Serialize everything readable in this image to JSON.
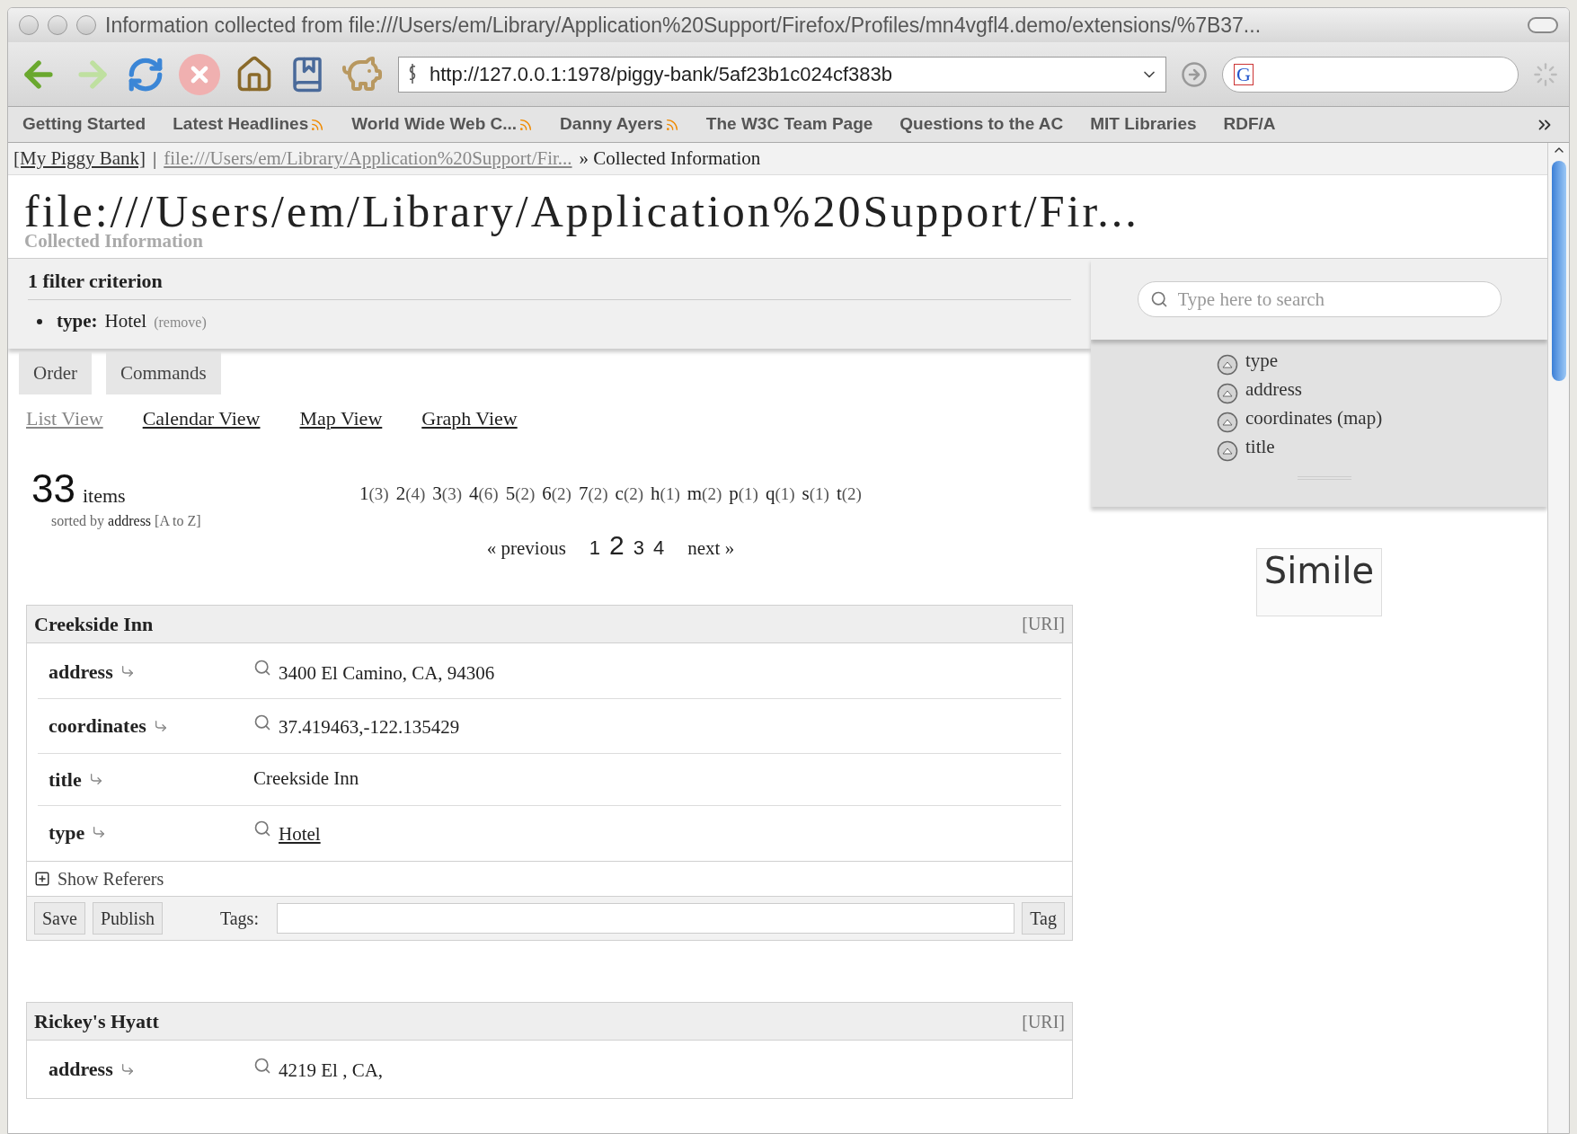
{
  "window": {
    "title": "Information collected from file:///Users/em/Library/Application%20Support/Firefox/Profiles/mn4vgfl4.demo/extensions/%7B37..."
  },
  "toolbar": {
    "url": "http://127.0.0.1:1978/piggy-bank/5af23b1c024cf383b",
    "search_engine": "G"
  },
  "bookmarks": [
    {
      "label": "Getting Started",
      "feed": false
    },
    {
      "label": "Latest Headlines",
      "feed": true
    },
    {
      "label": "World Wide Web C...",
      "feed": true
    },
    {
      "label": "Danny Ayers",
      "feed": true
    },
    {
      "label": "The W3C Team Page",
      "feed": false
    },
    {
      "label": "Questions to the AC",
      "feed": false
    },
    {
      "label": "MIT Libraries",
      "feed": false
    },
    {
      "label": "RDF/A",
      "feed": false
    }
  ],
  "breadcrumb": {
    "home": "[My Piggy Bank]",
    "separator": "|",
    "source": "file:///Users/em/Library/Application%20Support/Fir...",
    "current": "» Collected Information"
  },
  "header": {
    "title": "file:///Users/em/Library/Application%20Support/Fir...",
    "subtitle": "Collected Information"
  },
  "filters": {
    "heading": "1 filter criterion",
    "items": [
      {
        "key": "type:",
        "value": "Hotel",
        "remove": "(remove)"
      }
    ]
  },
  "command_tabs": [
    "Order",
    "Commands"
  ],
  "views": [
    {
      "label": "List View",
      "selected": true
    },
    {
      "label": "Calendar View",
      "selected": false
    },
    {
      "label": "Map View",
      "selected": false
    },
    {
      "label": "Graph View",
      "selected": false
    }
  ],
  "summary": {
    "count": "33",
    "unit": "items",
    "sorted_prefix": "sorted by",
    "sorted_field": "address",
    "sorted_order": "[A to Z]"
  },
  "index": [
    {
      "label": "1",
      "count": "(3)"
    },
    {
      "label": "2",
      "count": "(4)"
    },
    {
      "label": "3",
      "count": "(3)"
    },
    {
      "label": "4",
      "count": "(6)"
    },
    {
      "label": "5",
      "count": "(2)"
    },
    {
      "label": "6",
      "count": "(2)"
    },
    {
      "label": "7",
      "count": "(2)"
    },
    {
      "label": "c",
      "count": "(2)"
    },
    {
      "label": "h",
      "count": "(1)"
    },
    {
      "label": "m",
      "count": "(2)"
    },
    {
      "label": "p",
      "count": "(1)"
    },
    {
      "label": "q",
      "count": "(1)"
    },
    {
      "label": "s",
      "count": "(1)"
    },
    {
      "label": "t",
      "count": "(2)"
    }
  ],
  "pagination": {
    "previous": "« previous",
    "next": "next »",
    "pages": [
      {
        "label": "1",
        "selected": false
      },
      {
        "label": "2",
        "selected": true
      },
      {
        "label": "3",
        "selected": false
      },
      {
        "label": "4",
        "selected": false
      }
    ]
  },
  "items": [
    {
      "title": "Creekside Inn",
      "uri": "[URI]",
      "properties": [
        {
          "key": "address",
          "value": "3400 El Camino, CA, 94306",
          "searchable": true,
          "link": false
        },
        {
          "key": "coordinates",
          "value": "37.419463,-122.135429",
          "searchable": true,
          "link": false
        },
        {
          "key": "title",
          "value": "Creekside Inn",
          "searchable": false,
          "link": false
        },
        {
          "key": "type",
          "value": "Hotel",
          "searchable": true,
          "link": true
        }
      ],
      "referers": "Show Referers",
      "save": "Save",
      "publish": "Publish",
      "tags_label": "Tags:",
      "tag_button": "Tag"
    },
    {
      "title": "Rickey's Hyatt",
      "uri": "[URI]",
      "properties": [
        {
          "key": "address",
          "value": "4219 El , CA,",
          "searchable": true,
          "link": false
        }
      ]
    }
  ],
  "sidebar": {
    "search": {
      "placeholder": "Type here to search"
    },
    "facets": [
      "type",
      "address",
      "coordinates (map)",
      "title"
    ],
    "logo": "Simile"
  }
}
